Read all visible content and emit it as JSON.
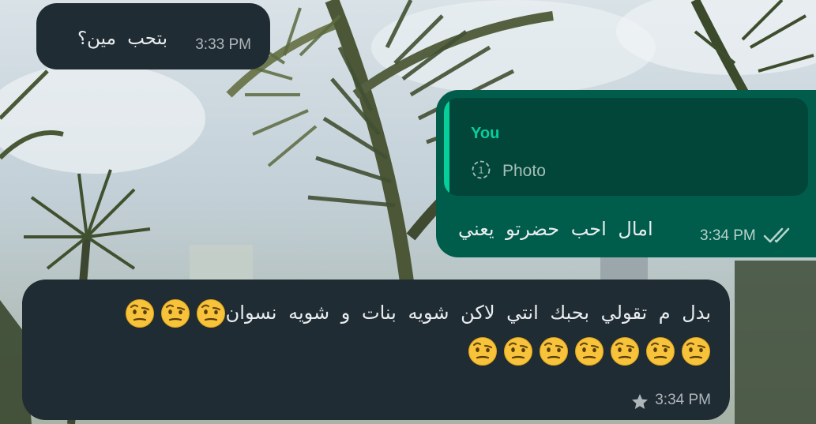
{
  "messages": [
    {
      "direction": "incoming",
      "text": "بتحب مين؟",
      "time": "3:33 PM"
    },
    {
      "direction": "outgoing",
      "quoted": {
        "author": "You",
        "caption": "Photo",
        "view_once_count": "1",
        "icon": "view-once-icon"
      },
      "text": "امال احب حضرتو يعني",
      "time": "3:34 PM",
      "status_icon": "double-check-icon"
    },
    {
      "direction": "incoming",
      "text": "بدل م تقولي بحبك انتي لاكن شويه بنات و شويه نسوان",
      "emoji_inline": [
        "🤨",
        "🤨",
        "🤨"
      ],
      "emoji_row": [
        "🤨",
        "🤨",
        "🤨",
        "🤨",
        "🤨",
        "🤨",
        "🤨"
      ],
      "time": "3:34 PM",
      "starred": true,
      "star_icon": "star-icon"
    }
  ],
  "colors": {
    "incoming_bubble": "#202c33",
    "outgoing_bubble": "#005c4b",
    "quote_accent": "#06cf9c",
    "text": "#e9edef"
  }
}
